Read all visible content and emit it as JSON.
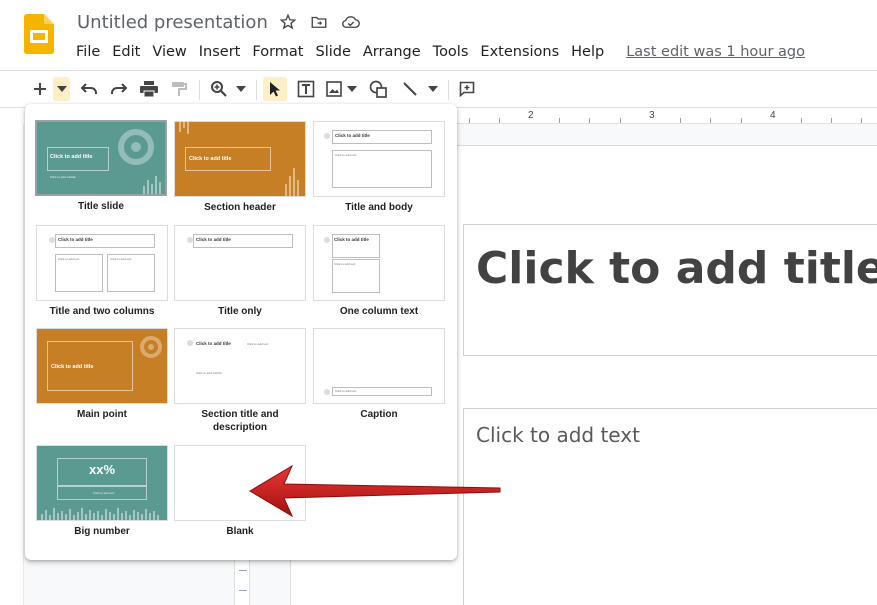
{
  "header": {
    "doc_title": "Untitled presentation",
    "menus": [
      "File",
      "Edit",
      "View",
      "Insert",
      "Format",
      "Slide",
      "Arrange",
      "Tools",
      "Extensions",
      "Help"
    ],
    "last_edit": "Last edit was 1 hour ago"
  },
  "toolbar": {
    "icons": [
      "new-slide-icon",
      "dropdown-icon",
      "undo-icon",
      "redo-icon",
      "print-icon",
      "paint-format-icon",
      "zoom-icon",
      "select-icon",
      "textbox-icon",
      "image-icon",
      "shape-icon",
      "line-icon",
      "comment-icon"
    ]
  },
  "ruler": {
    "numbers": [
      "2",
      "3",
      "4"
    ]
  },
  "slide": {
    "title_placeholder": "Click to add title",
    "body_placeholder": "Click to add text"
  },
  "layout_menu": {
    "layouts": [
      {
        "label": "Title slide",
        "thumb_title": "Click to add title",
        "thumb_sub": "Click to add subtitle"
      },
      {
        "label": "Section header",
        "thumb_title": "Click to add title"
      },
      {
        "label": "Title and body",
        "thumb_title": "Click to add title",
        "thumb_sub": "Click to add text"
      },
      {
        "label": "Title and two columns",
        "thumb_title": "Click to add title",
        "thumb_sub": "Click to add text",
        "thumb_sub2": "Click to add text"
      },
      {
        "label": "Title only",
        "thumb_title": "Click to add title"
      },
      {
        "label": "One column text",
        "thumb_title": "Click to add title",
        "thumb_sub": "Click to add text"
      },
      {
        "label": "Main point",
        "thumb_title": "Click to add title"
      },
      {
        "label": "Section title and description",
        "thumb_title": "Click to add title",
        "thumb_sub": "Click to add subtitle",
        "thumb_sub2": "Click to add text"
      },
      {
        "label": "Caption",
        "thumb_sub": "Click to add text"
      },
      {
        "label": "Big number",
        "thumb_title": "xx%",
        "thumb_sub": "Click to add text"
      },
      {
        "label": "Blank"
      }
    ]
  },
  "colors": {
    "brand_yellow": "#f4b400",
    "teal": "#5a9a90",
    "orange": "#c67f24",
    "arrow_red": "#d01c1c",
    "active_button": "#fdefc6"
  }
}
